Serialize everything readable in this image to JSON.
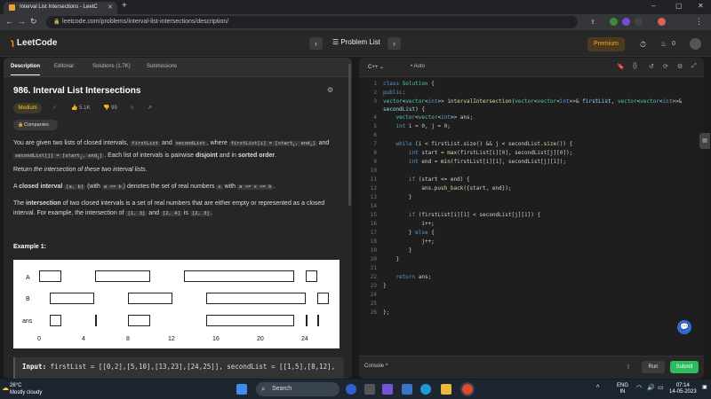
{
  "browser": {
    "tab_title": "Interval List Intersections - LeetC",
    "url": "leetcode.com/problems/interval-list-intersections/description/",
    "min": "–",
    "max": "▢",
    "close": "✕",
    "new_tab": "+"
  },
  "header": {
    "logo": "LeetCode",
    "problem_list": "Problem List",
    "premium": "Premium",
    "notif_count": "0"
  },
  "left": {
    "tabs": [
      "Description",
      "Editorial",
      "Solutions (1.7K)",
      "Submissions"
    ],
    "title": "986. Interval List Intersections",
    "difficulty": "Medium",
    "likes": "5.1K",
    "dislikes": "99",
    "companies": "Companies",
    "p1_a": "You are given two lists of closed intervals,",
    "p1_c1": "firstList",
    "p1_b": "and",
    "p1_c2": "secondList",
    "p1_c": ", where",
    "p1_c3": "firstList[i] = [start",
    "p1_d": "and",
    "p1_c4": "secondList[j] = [start",
    "p1_e": ". Each list of intervals is pairwise",
    "p1_f": "disjoint",
    "p1_g": "and in",
    "p1_h": "sorted order",
    "p2_a": "Return",
    "p2_b": "the intersection of these two interval lists.",
    "p3_a": "A",
    "p3_b": "closed interval",
    "p3_c1": "[a, b]",
    "p3_c": "(with",
    "p3_c2": "a <= b",
    "p3_d": ") denotes the set of real numbers",
    "p3_c3": "x",
    "p3_e": "with",
    "p3_c4": "a <= x <= b",
    "p4_a": "The",
    "p4_b": "intersection",
    "p4_c": "of two closed intervals is a set of real numbers that are either empty or represented as a closed interval. For example, the intersection of",
    "p4_c1": "[1, 3]",
    "p4_d": "and",
    "p4_c2": "[2, 4]",
    "p4_e": "is",
    "p4_c3": "[2, 3]",
    "example_heading": "Example 1:",
    "diagram": {
      "labels": [
        "A",
        "B",
        "ans"
      ],
      "ticks": [
        "0",
        "4",
        "8",
        "12",
        "16",
        "20",
        "24"
      ]
    },
    "input_label": "Input:",
    "input_text": "firstList = [[0,2],[5,10],[13,23],[24,25]], secondList = [[1,5],[8,12],"
  },
  "right": {
    "lang": "C++",
    "auto": "Auto",
    "console": "Console ^",
    "run": "Run",
    "submit": "Submit",
    "lines": [
      "1",
      "2",
      "3",
      "4",
      "5",
      "6",
      "7",
      "8",
      "9",
      "10",
      "11",
      "12",
      "13",
      "14",
      "15",
      "16",
      "17",
      "18",
      "19",
      "20",
      "21",
      "22",
      "23",
      "24",
      "25",
      "26"
    ]
  },
  "taskbar": {
    "temp": "26°C",
    "weather": "Mostly cloudy",
    "search": "Search",
    "lang1": "ENG",
    "lang2": "IN",
    "time": "07:14",
    "date": "14-05-2023"
  }
}
